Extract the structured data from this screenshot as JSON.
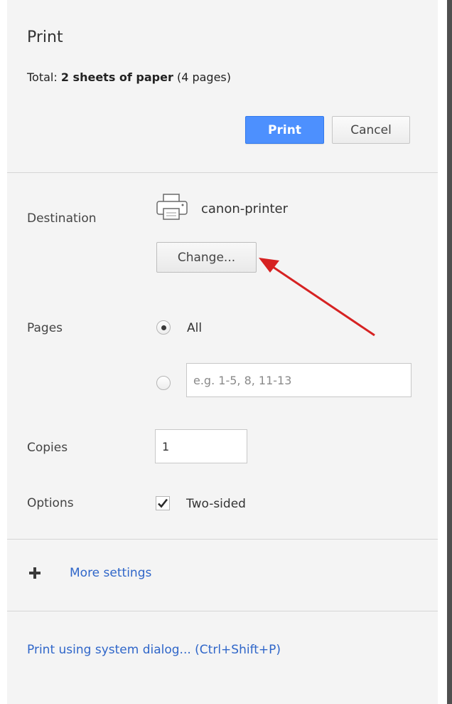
{
  "header": {
    "title": "Print",
    "total_prefix": "Total: ",
    "total_bold": "2 sheets of paper",
    "total_suffix": " (4 pages)",
    "print_label": "Print",
    "cancel_label": "Cancel"
  },
  "destination": {
    "label": "Destination",
    "printer_name": "canon-printer",
    "printer_icon": "printer-icon",
    "change_label": "Change..."
  },
  "pages": {
    "label": "Pages",
    "all_label": "All",
    "selected": "All",
    "range_value": "",
    "range_placeholder": "e.g. 1-5, 8, 11-13"
  },
  "copies": {
    "label": "Copies",
    "value": "1"
  },
  "options": {
    "label": "Options",
    "two_sided_label": "Two-sided",
    "two_sided_checked": true
  },
  "more_settings": {
    "icon": "plus-icon",
    "label": "More settings"
  },
  "system_dialog": {
    "label": "Print using system dialog... (Ctrl+Shift+P)"
  },
  "annotation": {
    "arrow_color": "#d62222"
  },
  "colors": {
    "accent": "#4d90fe",
    "link": "#2f66c9",
    "panel_background": "#f4f4f4"
  }
}
